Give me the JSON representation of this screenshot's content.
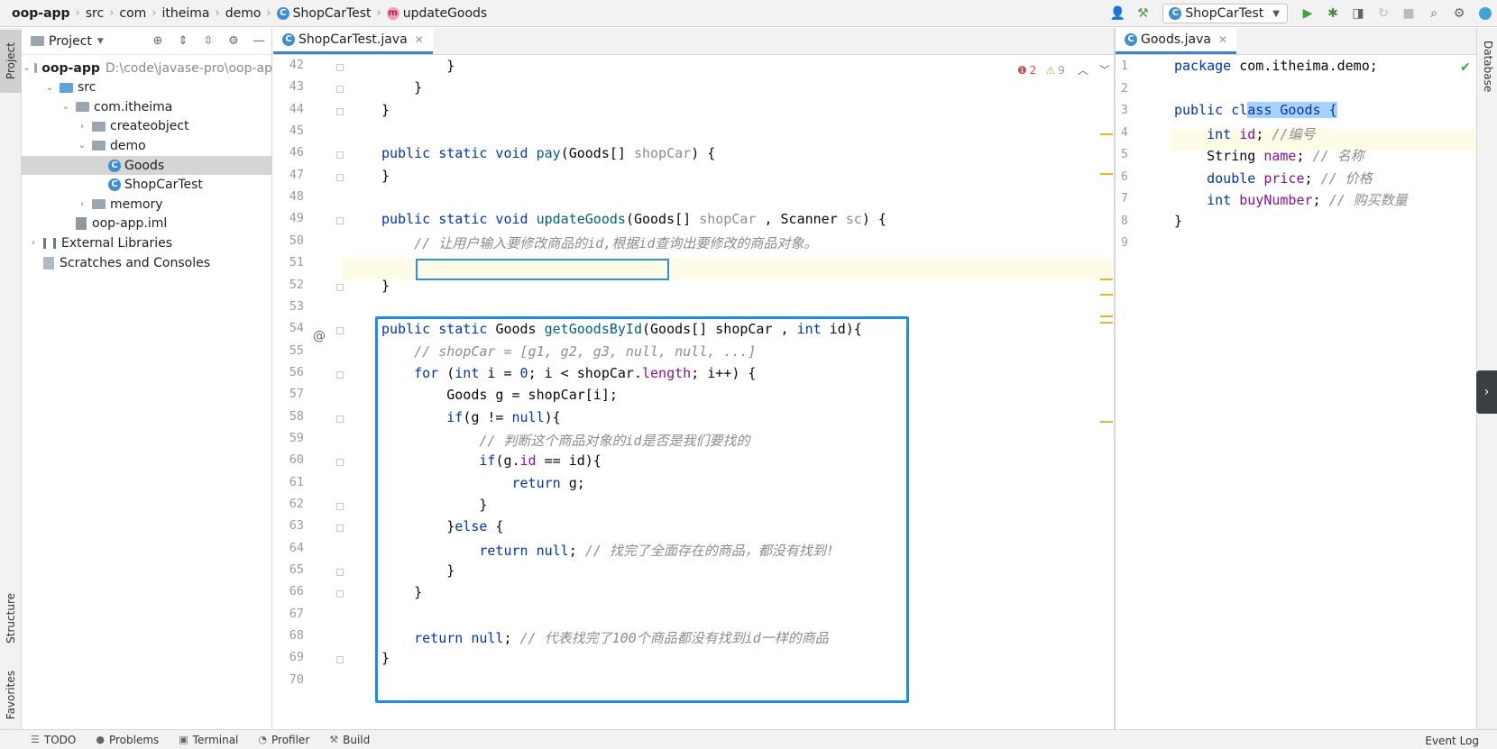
{
  "breadcrumb": [
    "oop-app",
    "src",
    "com",
    "itheima",
    "demo",
    "ShopCarTest",
    "updateGoods"
  ],
  "toolbar": {
    "run_config": "ShopCarTest"
  },
  "left_strip": {
    "project": "Project",
    "structure": "Structure",
    "favorites": "Favorites"
  },
  "project_panel": {
    "title": "Project",
    "tree": [
      {
        "label": "oop-app",
        "note": "D:\\code\\javase-pro\\oop-ap",
        "depth": 0,
        "expanded": true,
        "kind": "module"
      },
      {
        "label": "src",
        "depth": 1,
        "expanded": true,
        "kind": "src"
      },
      {
        "label": "com.itheima",
        "depth": 2,
        "expanded": true,
        "kind": "package"
      },
      {
        "label": "createobject",
        "depth": 3,
        "expanded": false,
        "kind": "package"
      },
      {
        "label": "demo",
        "depth": 3,
        "expanded": true,
        "kind": "package"
      },
      {
        "label": "Goods",
        "depth": 4,
        "kind": "class",
        "selected": true
      },
      {
        "label": "ShopCarTest",
        "depth": 4,
        "kind": "class"
      },
      {
        "label": "memory",
        "depth": 3,
        "expanded": false,
        "kind": "package"
      },
      {
        "label": "oop-app.iml",
        "depth": 2,
        "kind": "file"
      },
      {
        "label": "External Libraries",
        "depth": 0,
        "expanded": false,
        "kind": "lib"
      },
      {
        "label": "Scratches and Consoles",
        "depth": 0,
        "kind": "scratch"
      }
    ]
  },
  "editor_left": {
    "tab": "ShopCarTest.java",
    "inspection": {
      "errors": "2",
      "warnings": "9"
    },
    "line_numbers": [
      "42",
      "43",
      "44",
      "45",
      "46",
      "47",
      "48",
      "49",
      "50",
      "51",
      "52",
      "53",
      "54",
      "55",
      "56",
      "57",
      "58",
      "59",
      "60",
      "61",
      "62",
      "63",
      "64",
      "65",
      "66",
      "67",
      "68",
      "69",
      "70"
    ],
    "lines": [
      [
        {
          "t": "        }"
        }
      ],
      [
        {
          "t": "    }"
        }
      ],
      [
        {
          "t": "}"
        }
      ],
      [],
      [
        {
          "t": "public static void ",
          "c": "kw"
        },
        {
          "t": "pay",
          "c": "fn"
        },
        {
          "t": "(Goods[] "
        },
        {
          "t": "shopCar",
          "c": "dim"
        },
        {
          "t": ") {"
        }
      ],
      [
        {
          "t": "}"
        }
      ],
      [],
      [
        {
          "t": "public static void ",
          "c": "kw"
        },
        {
          "t": "updateGoods",
          "c": "fn"
        },
        {
          "t": "(Goods[] "
        },
        {
          "t": "shopCar",
          "c": "dim"
        },
        {
          "t": " , Scanner "
        },
        {
          "t": "sc",
          "c": "dim"
        },
        {
          "t": ") {"
        }
      ],
      [
        {
          "t": "    // 让用户输入要修改商品的id,根据id查询出要修改的商品对象。",
          "c": "cm"
        }
      ],
      [],
      [
        {
          "t": "}"
        }
      ],
      [],
      [
        {
          "t": "public static ",
          "c": "kw"
        },
        {
          "t": "Goods "
        },
        {
          "t": "getGoodsById",
          "c": "fn"
        },
        {
          "t": "(Goods[] shopCar , "
        },
        {
          "t": "int ",
          "c": "kw"
        },
        {
          "t": "id){"
        }
      ],
      [
        {
          "t": "    // shopCar = [g1, g2, g3, null, null, ...]",
          "c": "cm"
        }
      ],
      [
        {
          "t": "    "
        },
        {
          "t": "for",
          "c": "kw"
        },
        {
          "t": " ("
        },
        {
          "t": "int ",
          "c": "kw"
        },
        {
          "t": "i = "
        },
        {
          "t": "0",
          "c": "kw"
        },
        {
          "t": "; i < shopCar."
        },
        {
          "t": "length",
          "c": "pr"
        },
        {
          "t": "; i++) {"
        }
      ],
      [
        {
          "t": "        Goods g = shopCar[i];"
        }
      ],
      [
        {
          "t": "        "
        },
        {
          "t": "if",
          "c": "kw"
        },
        {
          "t": "(g != "
        },
        {
          "t": "null",
          "c": "kw"
        },
        {
          "t": "){"
        }
      ],
      [
        {
          "t": "            // 判断这个商品对象的id是否是我们要找的",
          "c": "cm"
        }
      ],
      [
        {
          "t": "            "
        },
        {
          "t": "if",
          "c": "kw"
        },
        {
          "t": "(g."
        },
        {
          "t": "id",
          "c": "pr"
        },
        {
          "t": " == id){"
        }
      ],
      [
        {
          "t": "                "
        },
        {
          "t": "return ",
          "c": "kw"
        },
        {
          "t": "g;"
        }
      ],
      [
        {
          "t": "            }"
        }
      ],
      [
        {
          "t": "        }"
        },
        {
          "t": "else",
          "c": "kw"
        },
        {
          "t": " {"
        }
      ],
      [
        {
          "t": "            "
        },
        {
          "t": "return null",
          "c": "kw"
        },
        {
          "t": "; "
        },
        {
          "t": "// 找完了全面存在的商品，都没有找到!",
          "c": "cm"
        }
      ],
      [
        {
          "t": "        }"
        }
      ],
      [
        {
          "t": "    }"
        }
      ],
      [],
      [
        {
          "t": "    "
        },
        {
          "t": "return null",
          "c": "kw"
        },
        {
          "t": "; "
        },
        {
          "t": "// 代表找完了100个商品都没有找到id一样的商品",
          "c": "cm"
        }
      ],
      [
        {
          "t": "}"
        }
      ],
      []
    ]
  },
  "editor_right": {
    "tab": "Goods.java",
    "line_numbers": [
      "1",
      "2",
      "3",
      "4",
      "5",
      "6",
      "7",
      "8",
      "9"
    ],
    "lines": [
      [
        {
          "t": "package ",
          "c": "kw"
        },
        {
          "t": "com.itheima.demo;"
        }
      ],
      [],
      [
        {
          "t": "public ",
          "c": "kw"
        },
        {
          "t": "cl",
          "c": "kw"
        },
        {
          "t": "ass Goods {",
          "c": "kw",
          "sel": true
        }
      ],
      [
        {
          "t": "    "
        },
        {
          "t": "int ",
          "c": "kw"
        },
        {
          "t": "id",
          "c": "pr"
        },
        {
          "t": "; "
        },
        {
          "t": "//编号",
          "c": "cm"
        }
      ],
      [
        {
          "t": "    String "
        },
        {
          "t": "name",
          "c": "pr"
        },
        {
          "t": "; "
        },
        {
          "t": "// 名称",
          "c": "cm"
        }
      ],
      [
        {
          "t": "    "
        },
        {
          "t": "double ",
          "c": "kw"
        },
        {
          "t": "price",
          "c": "pr"
        },
        {
          "t": "; "
        },
        {
          "t": "// 价格",
          "c": "cm"
        }
      ],
      [
        {
          "t": "    "
        },
        {
          "t": "int ",
          "c": "kw"
        },
        {
          "t": "buyNumber",
          "c": "pr"
        },
        {
          "t": "; "
        },
        {
          "t": "// 购买数量",
          "c": "cm"
        }
      ],
      [
        {
          "t": "}"
        }
      ],
      []
    ]
  },
  "right_strip": {
    "database": "Database"
  },
  "bottom_tabs": [
    "TODO",
    "Problems",
    "Terminal",
    "Profiler",
    "Build"
  ],
  "event_log": "Event Log"
}
